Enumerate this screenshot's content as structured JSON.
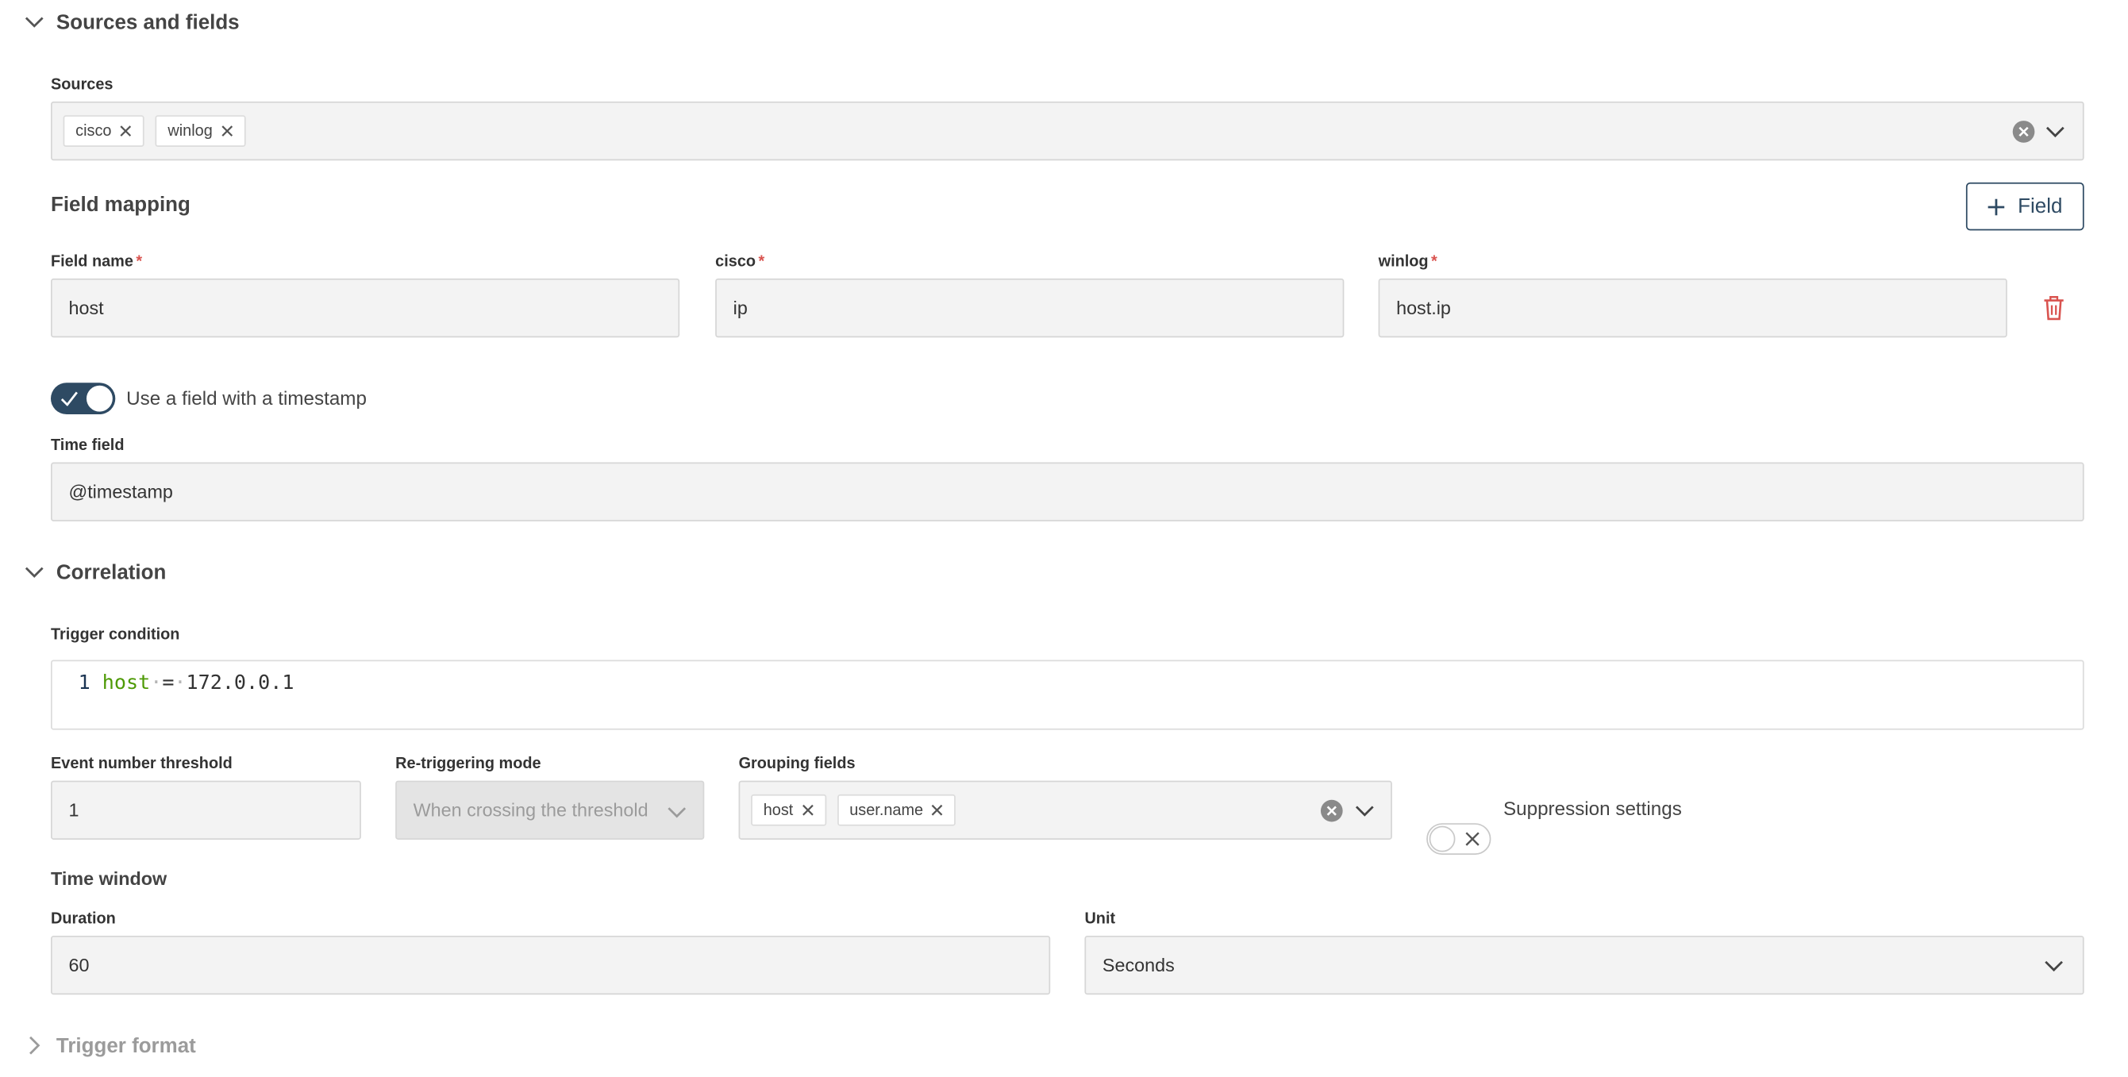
{
  "sources_section": {
    "title": "Sources and fields",
    "sources_label": "Sources",
    "sources": [
      {
        "label": "cisco"
      },
      {
        "label": "winlog"
      }
    ]
  },
  "field_mapping": {
    "title": "Field mapping",
    "add_field_label": "Field",
    "columns": [
      {
        "label": "Field name",
        "required": "*",
        "value": "host"
      },
      {
        "label": "cisco",
        "required": "*",
        "value": "ip"
      },
      {
        "label": "winlog",
        "required": "*",
        "value": "host.ip"
      }
    ],
    "timestamp_toggle_label": "Use a field with a timestamp",
    "timestamp_toggle_on": true,
    "time_field_label": "Time field",
    "time_field_value": "@timestamp"
  },
  "correlation": {
    "title": "Correlation",
    "trigger_condition_label": "Trigger condition",
    "code": {
      "line_number": "1",
      "token_field": "host",
      "token_operator": "=",
      "token_value": "172.0.0.1"
    },
    "event_threshold_label": "Event number threshold",
    "event_threshold_value": "1",
    "retrigger_label": "Re-triggering mode",
    "retrigger_value": "When crossing the threshold",
    "grouping_label": "Grouping fields",
    "grouping_fields": [
      {
        "label": "host"
      },
      {
        "label": "user.name"
      }
    ],
    "suppression_label": "Suppression settings",
    "suppression_on": false,
    "time_window_title": "Time window",
    "duration_label": "Duration",
    "duration_value": "60",
    "unit_label": "Unit",
    "unit_value": "Seconds"
  },
  "trigger_format": {
    "title": "Trigger format"
  },
  "colors": {
    "accent": "#2e4a63",
    "required": "#d9534f",
    "delete_icon": "#d9534f",
    "code_keyword": "#4e9a06"
  }
}
